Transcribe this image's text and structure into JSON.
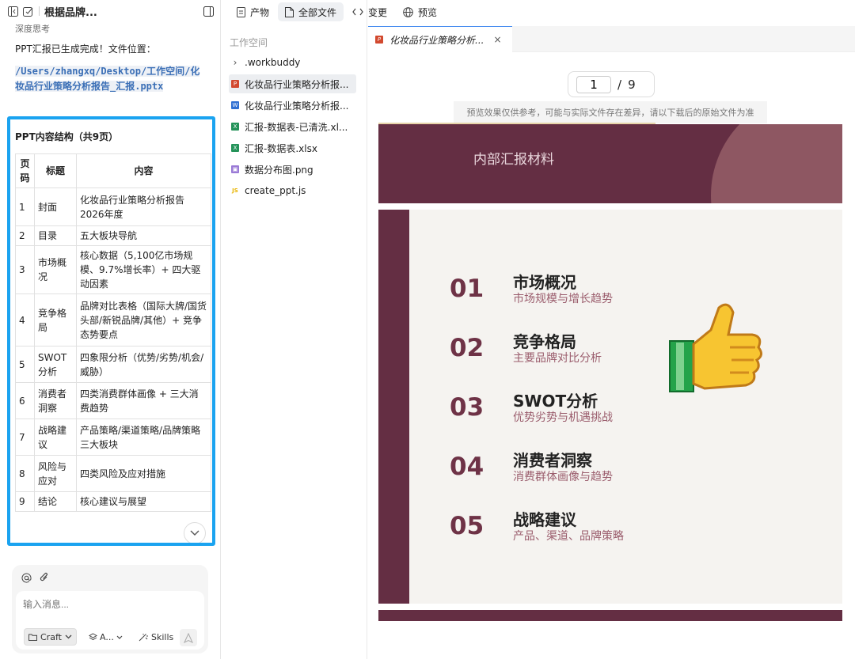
{
  "chat": {
    "title": "根据品牌...",
    "thinking_label": "深度思考",
    "done_message": "PPT汇报已生成完成！文件位置：",
    "file_path": "/Users/zhangxq/Desktop/工作空间/化妆品行业策略分析报告_汇报.pptx",
    "structure_heading": "PPT内容结构（共9页）",
    "table_headers": [
      "页码",
      "标题",
      "内容"
    ],
    "table_rows": [
      {
        "page": "1",
        "title": "封面",
        "content": "化妆品行业策略分析报告2026年度"
      },
      {
        "page": "2",
        "title": "目录",
        "content": "五大板块导航"
      },
      {
        "page": "3",
        "title": "市场概况",
        "content": "核心数据（5,100亿市场规模、9.7%增长率）+ 四大驱动因素"
      },
      {
        "page": "4",
        "title": "竞争格局",
        "content": "品牌对比表格（国际大牌/国货头部/新锐品牌/其他）+ 竞争态势要点"
      },
      {
        "page": "5",
        "title": "SWOT分析",
        "content": "四象限分析（优势/劣势/机会/威胁）"
      },
      {
        "page": "6",
        "title": "消费者洞察",
        "content": "四类消费群体画像 + 三大消费趋势"
      },
      {
        "page": "7",
        "title": "战略建议",
        "content": "产品策略/渠道策略/品牌策略三大板块"
      },
      {
        "page": "8",
        "title": "风险与应对",
        "content": "四类风险及应对措施"
      },
      {
        "page": "9",
        "title": "结论",
        "content": "核心建议与展望"
      }
    ]
  },
  "composer": {
    "placeholder": "输入消息...",
    "mode_label": "Craft",
    "model_label": "A...",
    "skills_label": "Skills"
  },
  "toptabs": [
    {
      "label": "产物",
      "icon": "doc-icon"
    },
    {
      "label": "全部文件",
      "icon": "file-icon",
      "active": true
    },
    {
      "label": "变更",
      "icon": "code-icon"
    },
    {
      "label": "预览",
      "icon": "globe-icon"
    }
  ],
  "workspace": {
    "label": "工作空间",
    "files": [
      {
        "name": ".workbuddy",
        "type": "folder"
      },
      {
        "name": "化妆品行业策略分析报...",
        "type": "pptx",
        "selected": true
      },
      {
        "name": "化妆品行业策略分析报...",
        "type": "docx"
      },
      {
        "name": "汇报-数据表-已清洗.xl...",
        "type": "xlsx"
      },
      {
        "name": "汇报-数据表.xlsx",
        "type": "xlsx"
      },
      {
        "name": "数据分布图.png",
        "type": "png"
      },
      {
        "name": "create_ppt.js",
        "type": "js"
      }
    ]
  },
  "preview": {
    "tab_title": "化妆品行业策略分析...",
    "current_page": "1",
    "separator": "/",
    "total_pages": "9",
    "notice": "预览效果仅供参考，可能与实际文件存在差异，请以下载后的原始文件为准"
  },
  "slide": {
    "header": "内部汇报材料",
    "items": [
      {
        "num": "01",
        "title": "市场概况",
        "sub": "市场规模与增长趋势"
      },
      {
        "num": "02",
        "title": "竞争格局",
        "sub": "主要品牌对比分析"
      },
      {
        "num": "03",
        "title": "SWOT分析",
        "sub": "优势劣势与机遇挑战"
      },
      {
        "num": "04",
        "title": "消费者洞察",
        "sub": "消费群体画像与趋势"
      },
      {
        "num": "05",
        "title": "战略建议",
        "sub": "产品、渠道、品牌策略"
      }
    ]
  },
  "colors": {
    "accent": "#1aa3f0",
    "slide_primary": "#642e43",
    "link": "#3b6fb6"
  }
}
